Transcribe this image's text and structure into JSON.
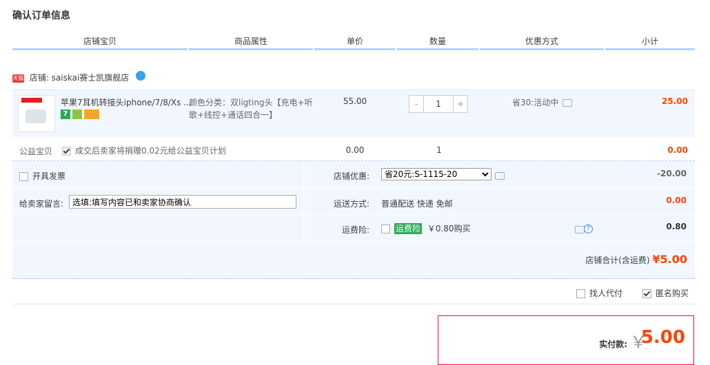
{
  "page_title": "确认订单信息",
  "columns": [
    "店铺宝贝",
    "商品属性",
    "单价",
    "数量",
    "优惠方式",
    "小计"
  ],
  "shop": {
    "badge": "天猫",
    "label": "店铺: saiskai赛士凯旗舰店"
  },
  "item": {
    "name": "苹果7耳机转接头iphone/7/8/Xs ...",
    "attr": "颜色分类：双ligting头【充电+听歌+线控+通话四合一】",
    "price": "55.00",
    "quantity": "1",
    "minus": "-",
    "plus": "+",
    "promo": "省30:活动中",
    "subtotal": "25.00",
    "badge_text": "7"
  },
  "charity": {
    "label": "公益宝贝",
    "text": "成交后卖家将捐赠0.02元给公益宝贝计划",
    "price": "0.00",
    "qty": "1",
    "subtotal": "0.00"
  },
  "invoice": {
    "label": "开具发票"
  },
  "shop_discount": {
    "label": "店铺优惠:",
    "selected": "省20元:S-1115-20",
    "amount": "-20.00"
  },
  "memo": {
    "label": "给卖家留言:",
    "placeholder": "选填:填写内容已和卖家协商确认"
  },
  "shipping": {
    "label": "运送方式:",
    "value": "普通配送 快递 免邮",
    "amount": "0.00"
  },
  "insurance": {
    "label": "运费险:",
    "badge": "运费险",
    "text": "￥0.80购买",
    "amount": "0.80",
    "help": "?"
  },
  "shop_total": {
    "label": "店铺合计(含运费)",
    "amount": "¥5.00"
  },
  "options": {
    "proxy": "找人代付",
    "anonymous": "匿名购买"
  },
  "pay": {
    "label": "实付款:",
    "currency": "￥",
    "amount": "5.00"
  }
}
